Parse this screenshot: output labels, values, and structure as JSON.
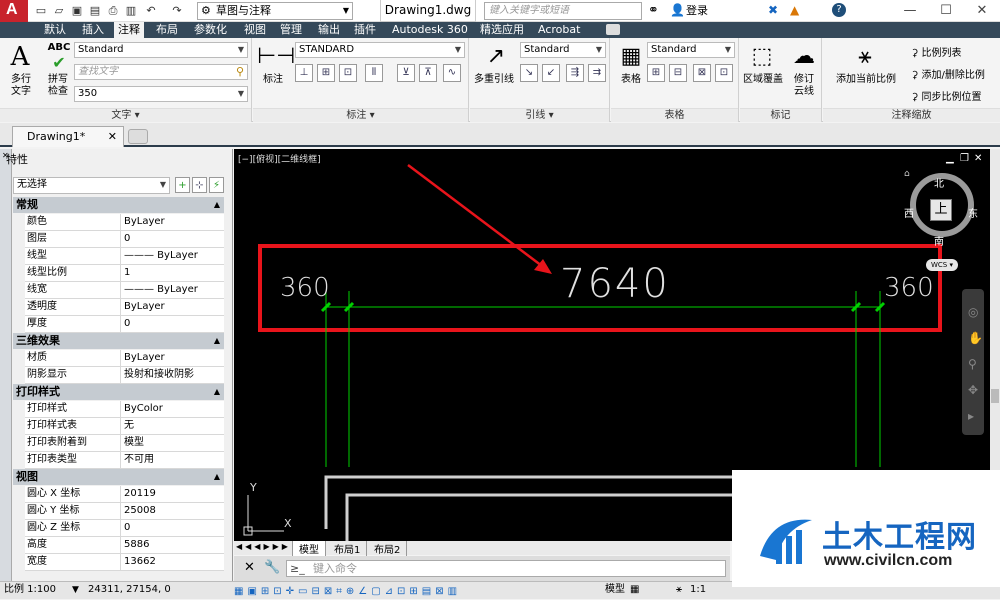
{
  "titlebar": {
    "workspace": "草图与注释",
    "doc_title": "Drawing1.dwg",
    "search_placeholder": "键入关键字或短语",
    "login": "登录",
    "win_min": "—",
    "win_max": "☐",
    "win_close": "✕"
  },
  "menus": [
    "默认",
    "插入",
    "注释",
    "布局",
    "参数化",
    "视图",
    "管理",
    "输出",
    "插件",
    "Autodesk 360",
    "精选应用",
    "Acrobat"
  ],
  "ribbon": {
    "text_group": {
      "big_label": "多行\n文字",
      "spell_label": "拼写\n检查",
      "style": "Standard",
      "find_placeholder": "查找文字",
      "height": "350",
      "footer": "文字 ▾"
    },
    "dim_group": {
      "big_label": "标注",
      "style": "STANDARD",
      "footer": "标注 ▾"
    },
    "leader_group": {
      "big_label": "多重引线",
      "style": "Standard",
      "footer": "引线 ▾"
    },
    "table_group": {
      "big_label": "表格",
      "style": "Standard",
      "footer": "表格"
    },
    "mark_group": {
      "btn1": "区域覆盖",
      "btn2": "修订\n云线",
      "footer": "标记"
    },
    "scale_group": {
      "big_label": "添加当前比例",
      "item1": "比例列表",
      "item2": "添加/删除比例",
      "item3": "同步比例位置",
      "footer": "注释缩放"
    }
  },
  "file_tab": {
    "label": "Drawing1*"
  },
  "properties": {
    "title": "特性",
    "selection": "无选择",
    "sections": [
      {
        "name": "常规",
        "rows": [
          [
            "颜色",
            "ByLayer"
          ],
          [
            "图层",
            "0"
          ],
          [
            "线型",
            "——— ByLayer"
          ],
          [
            "线型比例",
            "1"
          ],
          [
            "线宽",
            "——— ByLayer"
          ],
          [
            "透明度",
            "ByLayer"
          ],
          [
            "厚度",
            "0"
          ]
        ]
      },
      {
        "name": "三维效果",
        "rows": [
          [
            "材质",
            "ByLayer"
          ],
          [
            "阴影显示",
            "投射和接收阴影"
          ]
        ]
      },
      {
        "name": "打印样式",
        "rows": [
          [
            "打印样式",
            "ByColor"
          ],
          [
            "打印样式表",
            "无"
          ],
          [
            "打印表附着到",
            "模型"
          ],
          [
            "打印表类型",
            "不可用"
          ]
        ]
      },
      {
        "name": "视图",
        "rows": [
          [
            "圆心 X 坐标",
            "20119"
          ],
          [
            "圆心 Y 坐标",
            "25008"
          ],
          [
            "圆心 Z 坐标",
            "0"
          ],
          [
            "高度",
            "5886"
          ],
          [
            "宽度",
            "13662"
          ]
        ]
      }
    ]
  },
  "canvas": {
    "viewport_label": "[−][俯视][二维线框]",
    "dim_main": "7640",
    "dim_left": "360",
    "dim_right": "360",
    "viewcube": {
      "north": "北",
      "south": "南",
      "east": "东",
      "west": "西",
      "face": "上",
      "wcs": "WCS ▾"
    },
    "ucs_y": "Y",
    "ucs_x": "X"
  },
  "layout_tabs": [
    "模型",
    "布局1",
    "布局2"
  ],
  "command": {
    "placeholder": "键入命令"
  },
  "status": {
    "scale": "比例 1:100",
    "coords": "24311, 27154, 0",
    "model": "模型",
    "anno_scale": "1:1"
  },
  "watermark": {
    "brand": "土木工程网",
    "url": "www.civilcn.com"
  },
  "colors": {
    "accent": "#c8232c",
    "dim_green": "#00d000",
    "highlight_red": "#e8141b",
    "menu_bg": "#35495a"
  }
}
